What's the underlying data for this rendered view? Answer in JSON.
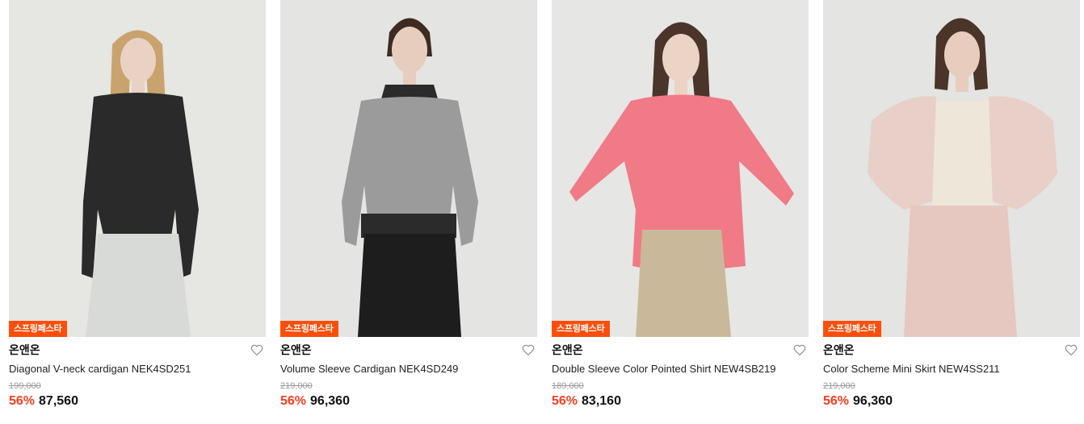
{
  "products": [
    {
      "badge": "스프링페스타",
      "brand": "온앤온",
      "name": "Diagonal V-neck cardigan NEK4SD251",
      "original_price": "199,000",
      "discount": "56%",
      "price": "87,560",
      "colors": {
        "bg": "#e6e6e2",
        "top": "#2a2a2a",
        "bottom": "#d7dad6",
        "hair": "#c9a36e",
        "skin": "#e9d2c4"
      }
    },
    {
      "badge": "스프링페스타",
      "brand": "온앤온",
      "name": "Volume Sleeve Cardigan NEK4SD249",
      "original_price": "219,000",
      "discount": "56%",
      "price": "96,360",
      "colors": {
        "bg": "#e4e4e2",
        "top": "#9b9b9b",
        "bottom": "#1d1d1d",
        "hair": "#3d2b22",
        "skin": "#e6cdbd"
      }
    },
    {
      "badge": "스프링페스타",
      "brand": "온앤온",
      "name": "Double Sleeve Color Pointed Shirt NEW4SB219",
      "original_price": "189,000",
      "discount": "56%",
      "price": "83,160",
      "colors": {
        "bg": "#e6e6e4",
        "top": "#f07a86",
        "bottom": "#c9b99a",
        "hair": "#4b342a",
        "skin": "#ebd3c5"
      }
    },
    {
      "badge": "스프링페스타",
      "brand": "온앤온",
      "name": "Color Scheme Mini Skirt NEW4SS211",
      "original_price": "219,000",
      "discount": "56%",
      "price": "96,360",
      "colors": {
        "bg": "#e4e4e2",
        "top": "#e8cfc8",
        "bottom": "#e6c8c0",
        "hair": "#4a3528",
        "skin": "#e8cdbf"
      }
    }
  ]
}
